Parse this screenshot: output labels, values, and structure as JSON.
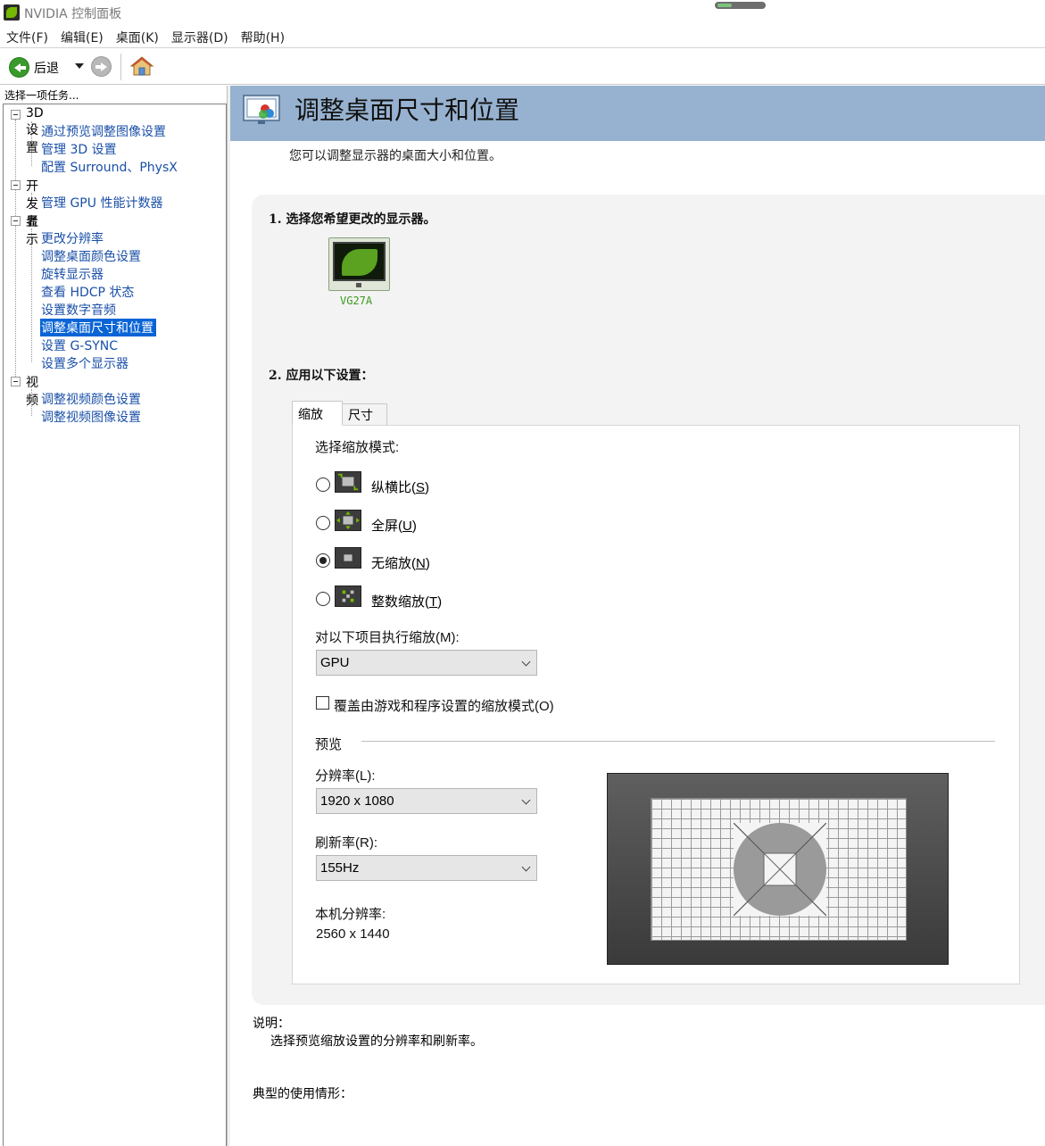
{
  "window": {
    "title": "NVIDIA 控制面板"
  },
  "menu": [
    "文件(F)",
    "编辑(E)",
    "桌面(K)",
    "显示器(D)",
    "帮助(H)"
  ],
  "toolbar": {
    "back_label": "后退"
  },
  "sidebar": {
    "header": "选择一项任务...",
    "categories": [
      {
        "label": "3D 设置",
        "items": [
          "通过预览调整图像设置",
          "管理 3D 设置",
          "配置 Surround、PhysX"
        ]
      },
      {
        "label": "开发者",
        "items": [
          "管理 GPU 性能计数器"
        ]
      },
      {
        "label": "显示",
        "items": [
          "更改分辨率",
          "调整桌面颜色设置",
          "旋转显示器",
          "查看 HDCP 状态",
          "设置数字音频",
          "调整桌面尺寸和位置",
          "设置 G-SYNC",
          "设置多个显示器"
        ]
      },
      {
        "label": "视频",
        "items": [
          "调整视频颜色设置",
          "调整视频图像设置"
        ]
      }
    ],
    "selected": "调整桌面尺寸和位置"
  },
  "page": {
    "title": "调整桌面尺寸和位置",
    "description": "您可以调整显示器的桌面大小和位置。",
    "step1": "1.  选择您希望更改的显示器。",
    "monitor_name": "VG27A",
    "step2": "2.  应用以下设置：",
    "tabs": [
      "缩放",
      "尺寸"
    ],
    "scaling_mode_label": "选择缩放模式:",
    "scaling_options": [
      {
        "label": "纵横比(",
        "key": "S",
        "suffix": ")",
        "checked": false,
        "icon": "aspect-ratio-icon"
      },
      {
        "label": "全屏(",
        "key": "U",
        "suffix": ")",
        "checked": false,
        "icon": "fullscreen-icon"
      },
      {
        "label": "无缩放(",
        "key": "N",
        "suffix": ")",
        "checked": true,
        "icon": "no-scaling-icon"
      },
      {
        "label": "整数缩放(",
        "key": "T",
        "suffix": ")",
        "checked": false,
        "icon": "integer-scaling-icon"
      }
    ],
    "perform_scaling_label": "对以下项目执行缩放(M):",
    "perform_scaling_value": "GPU",
    "override_label": "覆盖由游戏和程序设置的缩放模式(O)",
    "override_checked": false,
    "preview_label": "预览",
    "resolution_label": "分辨率(L):",
    "resolution_value": "1920 x 1080",
    "refresh_label": "刷新率(R):",
    "refresh_value": "155Hz",
    "native_label": "本机分辨率:",
    "native_value": "2560 x 1440",
    "note_title": "说明：",
    "note_text": "选择预览缩放设置的分辨率和刷新率。",
    "usage_title": "典型的使用情形："
  },
  "colors": {
    "header_bg": "#97b2d0",
    "link": "#1a4fa8",
    "selected_bg": "#0a64d6",
    "nvidia_green": "#76b900"
  }
}
